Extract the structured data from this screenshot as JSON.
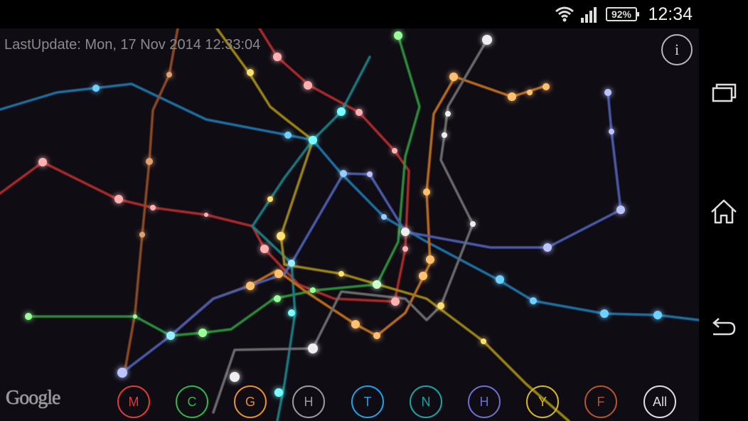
{
  "status_bar": {
    "battery": "92%",
    "time": "12:34",
    "wifi_icon": "wifi-icon",
    "signal_icon": "cell-signal-icon"
  },
  "map": {
    "last_update": "LastUpdate: Mon, 17 Nov 2014 12:33:04",
    "info_label": "i",
    "google_label": "Google"
  },
  "filters": [
    {
      "label": "M",
      "color": "#e23a3a"
    },
    {
      "label": "C",
      "color": "#2fb84a"
    },
    {
      "label": "G",
      "color": "#e8902a"
    },
    {
      "label": "H",
      "color": "#9a9a9a"
    },
    {
      "label": "T",
      "color": "#1aa3e8"
    },
    {
      "label": "N",
      "color": "#16a6a6"
    },
    {
      "label": "H",
      "color": "#6a6fd0"
    },
    {
      "label": "Y",
      "color": "#d4b820"
    },
    {
      "label": "F",
      "color": "#b5552a"
    },
    {
      "label": "All",
      "color": "#dddddd"
    }
  ],
  "nav": {
    "recent_icon": "recent-apps-icon",
    "home_icon": "home-icon",
    "back_icon": "back-icon"
  }
}
